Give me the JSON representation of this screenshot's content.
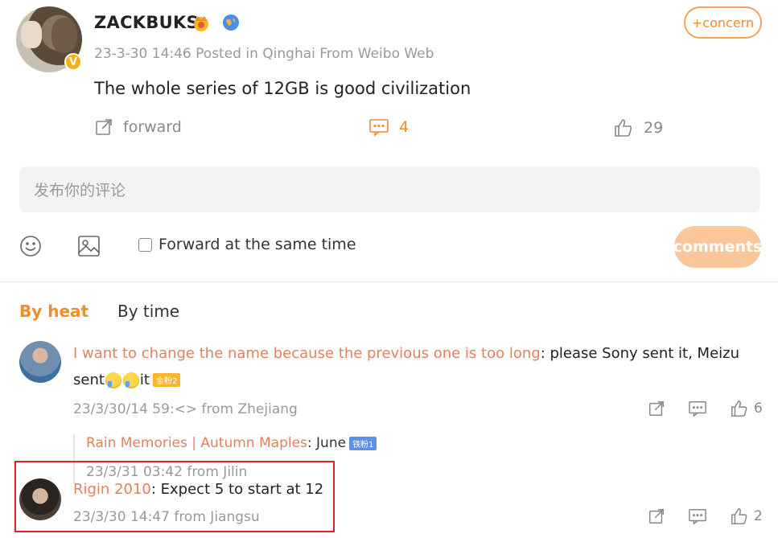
{
  "post": {
    "username": "ZACKBUKS",
    "verified_mark": "V",
    "follow_label": "+concern",
    "meta": "23-3-30 14:46  Posted in Qinghai  From Weibo Web",
    "text": "The whole series of 12GB is good civilization",
    "actions": {
      "forward_label": "forward",
      "comment_count": "4",
      "like_count": "29"
    }
  },
  "composer": {
    "placeholder": "发布你的评论",
    "forward_same_time_label": "Forward at the same time",
    "submit_label": "comments"
  },
  "sort_tabs": {
    "by_heat": "By heat",
    "by_time": "By time"
  },
  "comments": [
    {
      "user": "I want to change the name because the previous one is too long",
      "text_line1": ": please Sony sent it, Meizu",
      "text_line2_start": "sent",
      "text_line2_end": " it",
      "badge": "金粉2",
      "meta": "23/3/30/14 59:<> from Zhejiang",
      "like_count": "6",
      "reply": {
        "user": "Rain Memories | Autumn Maples",
        "text": ": June",
        "badge": "铁粉1",
        "meta": "23/3/31 03:42 from Jilin"
      }
    },
    {
      "user": "Rigin 2010",
      "text": ": Expect 5 to start at 12",
      "meta": "23/3/30 14:47 from Jiangsu",
      "like_count": "2"
    }
  ],
  "colors": {
    "accent": "#f08c2a",
    "link_name": "#e0825b",
    "highlight_border": "#d8232a",
    "submit_disabled": "#f9c79a"
  }
}
